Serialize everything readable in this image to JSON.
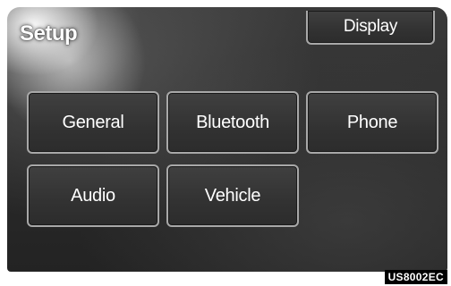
{
  "screen": {
    "title": "Setup"
  },
  "buttons": {
    "display": "Display",
    "general": "General",
    "bluetooth": "Bluetooth",
    "phone": "Phone",
    "audio": "Audio",
    "vehicle": "Vehicle"
  },
  "figure_code": "US8002EC"
}
